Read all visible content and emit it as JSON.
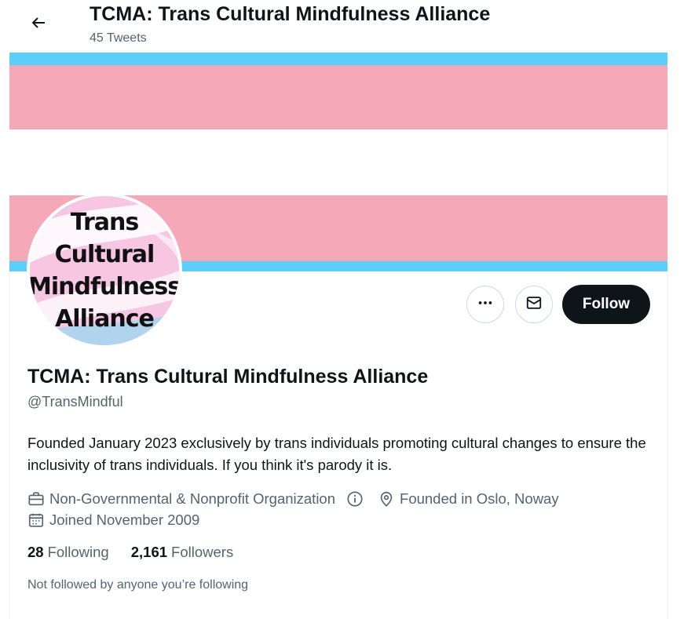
{
  "header": {
    "title": "TCMA: Trans Cultural Mindfulness Alliance",
    "tweet_count": "45 Tweets"
  },
  "banner": {
    "colors": [
      "#5bcefa",
      "#f5a9b8",
      "#ffffff",
      "#f5a9b8",
      "#5bcefa"
    ]
  },
  "avatar": {
    "lines": [
      "Trans",
      "Cultural",
      "Mindfulness",
      "Alliance"
    ]
  },
  "actions": {
    "more_icon": "more-horizontal-icon",
    "message_icon": "envelope-icon",
    "follow_label": "Follow"
  },
  "profile": {
    "display_name": "TCMA: Trans Cultural Mindfulness Alliance",
    "handle": "@TransMindful",
    "bio": "Founded January 2023 exclusively by trans individuals promoting cultural changes to ensure the inclusivity of trans individuals. If you think it's parody it is.",
    "category": "Non-Governmental & Nonprofit Organization",
    "location": "Founded in Oslo, Noway",
    "joined": "Joined November 2009"
  },
  "counts": {
    "following_num": "28",
    "following_label": "Following",
    "followers_num": "2,161",
    "followers_label": "Followers"
  },
  "not_followed_text": "Not followed by anyone you’re following"
}
